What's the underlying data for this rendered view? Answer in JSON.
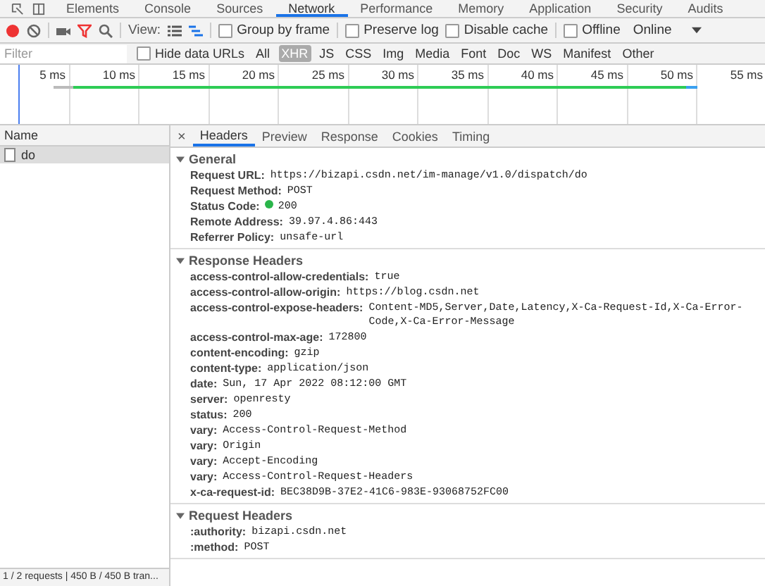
{
  "devtools_tabs": [
    {
      "label": "Elements",
      "selected": false
    },
    {
      "label": "Console",
      "selected": false
    },
    {
      "label": "Sources",
      "selected": false
    },
    {
      "label": "Network",
      "selected": true
    },
    {
      "label": "Performance",
      "selected": false
    },
    {
      "label": "Memory",
      "selected": false
    },
    {
      "label": "Application",
      "selected": false
    },
    {
      "label": "Security",
      "selected": false
    },
    {
      "label": "Audits",
      "selected": false
    }
  ],
  "toolbar": {
    "recording": true,
    "filter_active": true,
    "view_label": "View:",
    "view_modes": [
      {
        "kind": "list",
        "selected": false
      },
      {
        "kind": "waterfall",
        "selected": true
      }
    ],
    "options": [
      {
        "label": "Group by frame",
        "checked": false
      },
      {
        "label": "Preserve log",
        "checked": false
      },
      {
        "label": "Disable cache",
        "checked": false
      },
      {
        "label": "Offline",
        "checked": false
      }
    ],
    "throttling": "Online"
  },
  "filter_bar": {
    "placeholder": "Filter",
    "hide_data_urls": {
      "label": "Hide data URLs",
      "checked": false
    },
    "types": [
      {
        "label": "All",
        "selected": false
      },
      {
        "label": "XHR",
        "selected": true
      },
      {
        "label": "JS",
        "selected": false
      },
      {
        "label": "CSS",
        "selected": false
      },
      {
        "label": "Img",
        "selected": false
      },
      {
        "label": "Media",
        "selected": false
      },
      {
        "label": "Font",
        "selected": false
      },
      {
        "label": "Doc",
        "selected": false
      },
      {
        "label": "WS",
        "selected": false
      },
      {
        "label": "Manifest",
        "selected": false
      },
      {
        "label": "Other",
        "selected": false
      }
    ]
  },
  "timeline": {
    "ticks": [
      "5 ms",
      "10 ms",
      "15 ms",
      "20 ms",
      "25 ms",
      "30 ms",
      "35 ms",
      "40 ms",
      "45 ms",
      "50 ms",
      "55 ms"
    ]
  },
  "requests": {
    "column": "Name",
    "rows": [
      {
        "name": "do",
        "selected": true
      }
    ],
    "status": "1 / 2 requests | 450 B / 450 B tran..."
  },
  "details": {
    "close": "×",
    "tabs": [
      {
        "label": "Headers",
        "selected": true
      },
      {
        "label": "Preview",
        "selected": false
      },
      {
        "label": "Response",
        "selected": false
      },
      {
        "label": "Cookies",
        "selected": false
      },
      {
        "label": "Timing",
        "selected": false
      }
    ],
    "sections": [
      {
        "title": "General",
        "expanded": true,
        "rows": [
          {
            "kind": "plain",
            "key": "Request URL:",
            "value": "https://bizapi.csdn.net/im-manage/v1.0/dispatch/do"
          },
          {
            "kind": "plain",
            "key": "Request Method:",
            "value": "POST"
          },
          {
            "kind": "status",
            "key": "Status Code:",
            "value": "200"
          },
          {
            "kind": "plain",
            "key": "Remote Address:",
            "value": "39.97.4.86:443"
          },
          {
            "kind": "plain",
            "key": "Referrer Policy:",
            "value": "unsafe-url"
          }
        ]
      },
      {
        "title": "Response Headers",
        "expanded": true,
        "rows": [
          {
            "kind": "plain",
            "key": "access-control-allow-credentials:",
            "value": "true"
          },
          {
            "kind": "plain",
            "key": "access-control-allow-origin:",
            "value": "https://blog.csdn.net"
          },
          {
            "kind": "plain",
            "key": "access-control-expose-headers:",
            "value": "Content-MD5,Server,Date,Latency,X-Ca-Request-Id,X-Ca-Error-Code,X-Ca-Error-Message"
          },
          {
            "kind": "plain",
            "key": "access-control-max-age:",
            "value": "172800"
          },
          {
            "kind": "plain",
            "key": "content-encoding:",
            "value": "gzip"
          },
          {
            "kind": "plain",
            "key": "content-type:",
            "value": "application/json"
          },
          {
            "kind": "plain",
            "key": "date:",
            "value": "Sun, 17 Apr 2022 08:12:00 GMT"
          },
          {
            "kind": "plain",
            "key": "server:",
            "value": "openresty"
          },
          {
            "kind": "plain",
            "key": "status:",
            "value": "200"
          },
          {
            "kind": "plain",
            "key": "vary:",
            "value": "Access-Control-Request-Method"
          },
          {
            "kind": "plain",
            "key": "vary:",
            "value": "Origin"
          },
          {
            "kind": "plain",
            "key": "vary:",
            "value": "Accept-Encoding"
          },
          {
            "kind": "plain",
            "key": "vary:",
            "value": "Access-Control-Request-Headers"
          },
          {
            "kind": "plain",
            "key": "x-ca-request-id:",
            "value": "BEC38D9B-37E2-41C6-983E-93068752FC00"
          }
        ]
      },
      {
        "title": "Request Headers",
        "expanded": true,
        "rows": [
          {
            "kind": "plain",
            "key": ":authority:",
            "value": "bizapi.csdn.net"
          },
          {
            "kind": "plain",
            "key": ":method:",
            "value": "POST"
          }
        ]
      }
    ]
  }
}
